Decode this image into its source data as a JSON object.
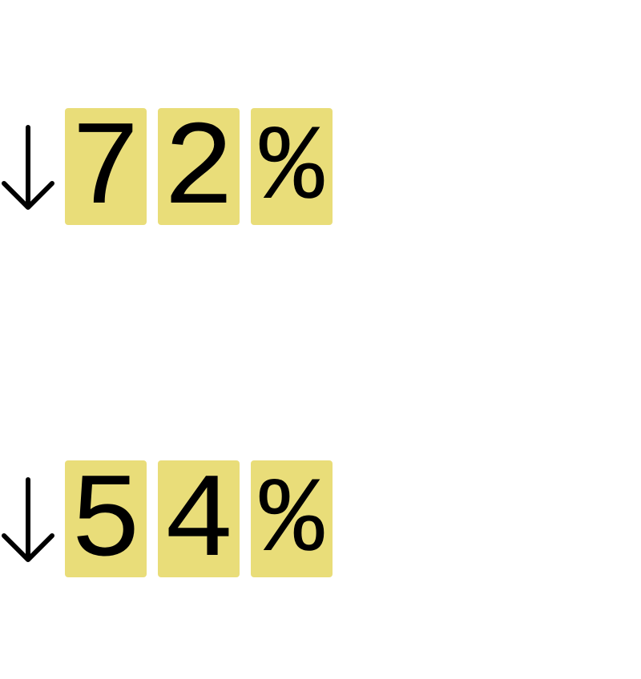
{
  "colors": {
    "tile": "#e9dd79",
    "text": "#000000",
    "background": "#ffffff"
  },
  "stats": [
    {
      "icon": "arrow-down-icon",
      "digits": [
        "7",
        "2",
        "%"
      ]
    },
    {
      "icon": "arrow-down-icon",
      "digits": [
        "5",
        "4",
        "%"
      ]
    }
  ]
}
